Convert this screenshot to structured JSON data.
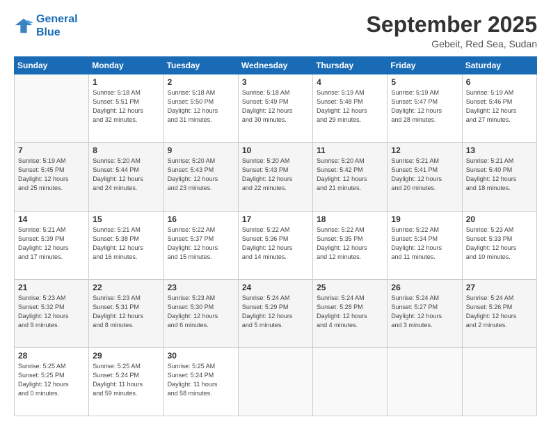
{
  "logo": {
    "line1": "General",
    "line2": "Blue"
  },
  "title": "September 2025",
  "subtitle": "Gebeit, Red Sea, Sudan",
  "weekdays": [
    "Sunday",
    "Monday",
    "Tuesday",
    "Wednesday",
    "Thursday",
    "Friday",
    "Saturday"
  ],
  "weeks": [
    [
      {
        "day": "",
        "info": ""
      },
      {
        "day": "1",
        "info": "Sunrise: 5:18 AM\nSunset: 5:51 PM\nDaylight: 12 hours\nand 32 minutes."
      },
      {
        "day": "2",
        "info": "Sunrise: 5:18 AM\nSunset: 5:50 PM\nDaylight: 12 hours\nand 31 minutes."
      },
      {
        "day": "3",
        "info": "Sunrise: 5:18 AM\nSunset: 5:49 PM\nDaylight: 12 hours\nand 30 minutes."
      },
      {
        "day": "4",
        "info": "Sunrise: 5:19 AM\nSunset: 5:48 PM\nDaylight: 12 hours\nand 29 minutes."
      },
      {
        "day": "5",
        "info": "Sunrise: 5:19 AM\nSunset: 5:47 PM\nDaylight: 12 hours\nand 28 minutes."
      },
      {
        "day": "6",
        "info": "Sunrise: 5:19 AM\nSunset: 5:46 PM\nDaylight: 12 hours\nand 27 minutes."
      }
    ],
    [
      {
        "day": "7",
        "info": "Sunrise: 5:19 AM\nSunset: 5:45 PM\nDaylight: 12 hours\nand 25 minutes."
      },
      {
        "day": "8",
        "info": "Sunrise: 5:20 AM\nSunset: 5:44 PM\nDaylight: 12 hours\nand 24 minutes."
      },
      {
        "day": "9",
        "info": "Sunrise: 5:20 AM\nSunset: 5:43 PM\nDaylight: 12 hours\nand 23 minutes."
      },
      {
        "day": "10",
        "info": "Sunrise: 5:20 AM\nSunset: 5:43 PM\nDaylight: 12 hours\nand 22 minutes."
      },
      {
        "day": "11",
        "info": "Sunrise: 5:20 AM\nSunset: 5:42 PM\nDaylight: 12 hours\nand 21 minutes."
      },
      {
        "day": "12",
        "info": "Sunrise: 5:21 AM\nSunset: 5:41 PM\nDaylight: 12 hours\nand 20 minutes."
      },
      {
        "day": "13",
        "info": "Sunrise: 5:21 AM\nSunset: 5:40 PM\nDaylight: 12 hours\nand 18 minutes."
      }
    ],
    [
      {
        "day": "14",
        "info": "Sunrise: 5:21 AM\nSunset: 5:39 PM\nDaylight: 12 hours\nand 17 minutes."
      },
      {
        "day": "15",
        "info": "Sunrise: 5:21 AM\nSunset: 5:38 PM\nDaylight: 12 hours\nand 16 minutes."
      },
      {
        "day": "16",
        "info": "Sunrise: 5:22 AM\nSunset: 5:37 PM\nDaylight: 12 hours\nand 15 minutes."
      },
      {
        "day": "17",
        "info": "Sunrise: 5:22 AM\nSunset: 5:36 PM\nDaylight: 12 hours\nand 14 minutes."
      },
      {
        "day": "18",
        "info": "Sunrise: 5:22 AM\nSunset: 5:35 PM\nDaylight: 12 hours\nand 12 minutes."
      },
      {
        "day": "19",
        "info": "Sunrise: 5:22 AM\nSunset: 5:34 PM\nDaylight: 12 hours\nand 11 minutes."
      },
      {
        "day": "20",
        "info": "Sunrise: 5:23 AM\nSunset: 5:33 PM\nDaylight: 12 hours\nand 10 minutes."
      }
    ],
    [
      {
        "day": "21",
        "info": "Sunrise: 5:23 AM\nSunset: 5:32 PM\nDaylight: 12 hours\nand 9 minutes."
      },
      {
        "day": "22",
        "info": "Sunrise: 5:23 AM\nSunset: 5:31 PM\nDaylight: 12 hours\nand 8 minutes."
      },
      {
        "day": "23",
        "info": "Sunrise: 5:23 AM\nSunset: 5:30 PM\nDaylight: 12 hours\nand 6 minutes."
      },
      {
        "day": "24",
        "info": "Sunrise: 5:24 AM\nSunset: 5:29 PM\nDaylight: 12 hours\nand 5 minutes."
      },
      {
        "day": "25",
        "info": "Sunrise: 5:24 AM\nSunset: 5:28 PM\nDaylight: 12 hours\nand 4 minutes."
      },
      {
        "day": "26",
        "info": "Sunrise: 5:24 AM\nSunset: 5:27 PM\nDaylight: 12 hours\nand 3 minutes."
      },
      {
        "day": "27",
        "info": "Sunrise: 5:24 AM\nSunset: 5:26 PM\nDaylight: 12 hours\nand 2 minutes."
      }
    ],
    [
      {
        "day": "28",
        "info": "Sunrise: 5:25 AM\nSunset: 5:25 PM\nDaylight: 12 hours\nand 0 minutes."
      },
      {
        "day": "29",
        "info": "Sunrise: 5:25 AM\nSunset: 5:24 PM\nDaylight: 11 hours\nand 59 minutes."
      },
      {
        "day": "30",
        "info": "Sunrise: 5:25 AM\nSunset: 5:24 PM\nDaylight: 11 hours\nand 58 minutes."
      },
      {
        "day": "",
        "info": ""
      },
      {
        "day": "",
        "info": ""
      },
      {
        "day": "",
        "info": ""
      },
      {
        "day": "",
        "info": ""
      }
    ]
  ]
}
